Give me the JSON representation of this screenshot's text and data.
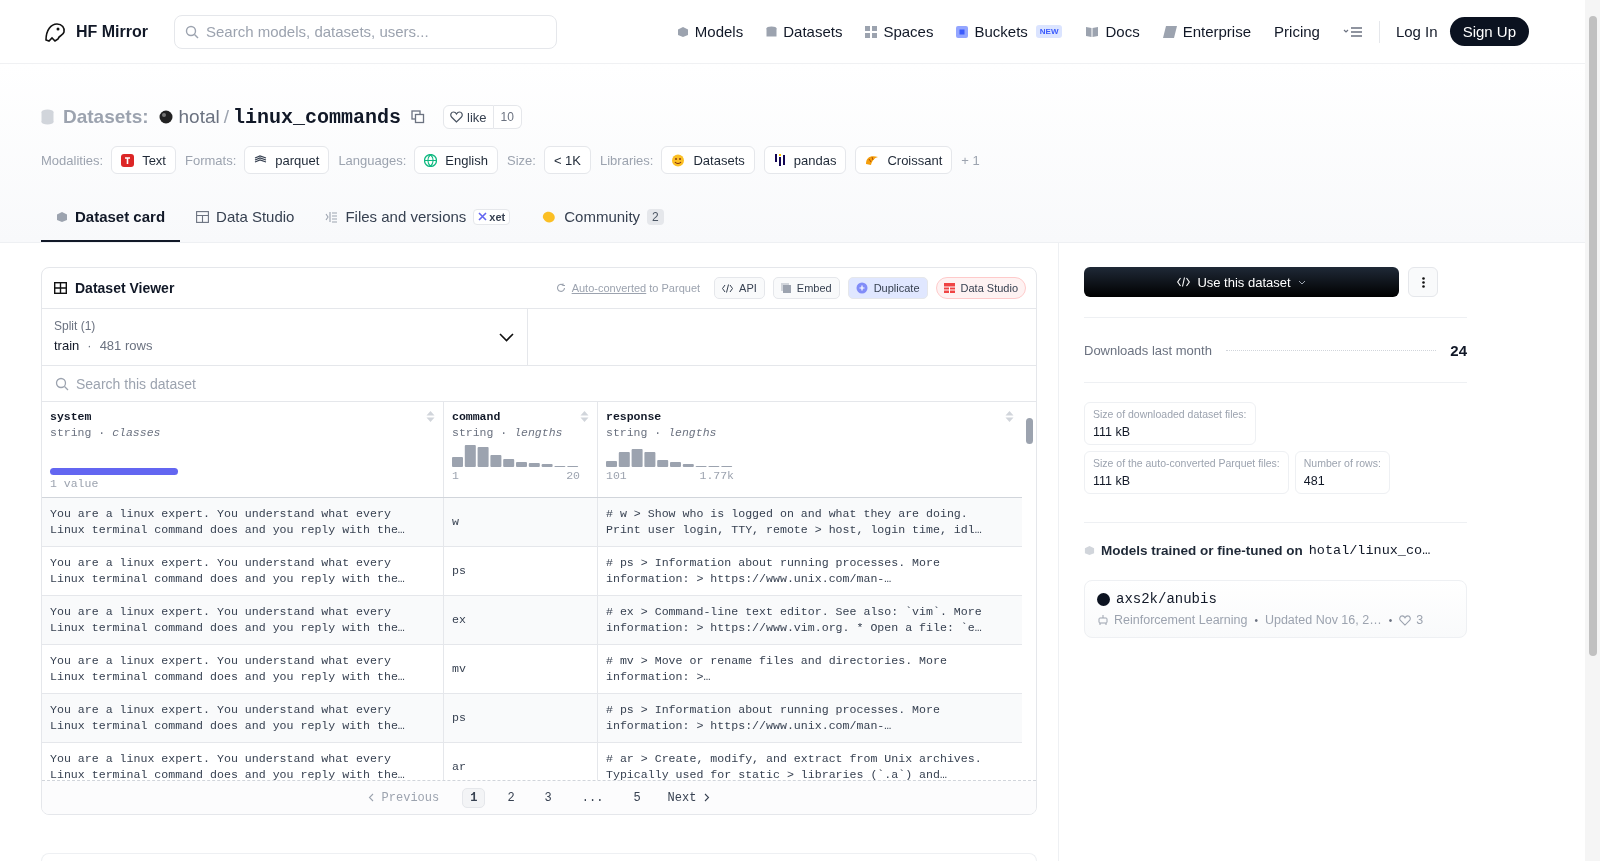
{
  "nav": {
    "logo": "HF Mirror",
    "search_placeholder": "Search models, datasets, users...",
    "links": [
      {
        "label": "Models",
        "kind": "models"
      },
      {
        "label": "Datasets",
        "kind": "datasets"
      },
      {
        "label": "Spaces",
        "kind": "spaces"
      },
      {
        "label": "Buckets",
        "kind": "buckets",
        "badge": "NEW"
      },
      {
        "label": "Docs",
        "kind": "docs"
      },
      {
        "label": "Enterprise",
        "kind": "enterprise"
      },
      {
        "label": "Pricing",
        "kind": "plain"
      }
    ],
    "login": "Log In",
    "signup": "Sign Up"
  },
  "repo": {
    "prefix": "Datasets:",
    "owner": "hotal",
    "separator": "/",
    "name": "linux_commands",
    "like": "like",
    "likes": "10"
  },
  "tag_groups": [
    {
      "label": "Modalities:",
      "items": [
        {
          "text": "Text",
          "kind": "text"
        }
      ]
    },
    {
      "label": "Formats:",
      "items": [
        {
          "text": "parquet",
          "kind": "parquet"
        }
      ]
    },
    {
      "label": "Languages:",
      "items": [
        {
          "text": "English",
          "kind": "globe"
        }
      ]
    },
    {
      "label": "Size:",
      "items": [
        {
          "text": "< 1K",
          "kind": "plain"
        }
      ]
    },
    {
      "label": "Libraries:",
      "items": [
        {
          "text": "Datasets",
          "kind": "hug"
        },
        {
          "text": "pandas",
          "kind": "pandas"
        },
        {
          "text": "Croissant",
          "kind": "croissant"
        }
      ]
    }
  ],
  "tags_more": "+ 1",
  "tabs": [
    {
      "label": "Dataset card",
      "kind": "card",
      "selected": true
    },
    {
      "label": "Data Studio",
      "kind": "table",
      "selected": false
    },
    {
      "label": "Files and versions",
      "kind": "files",
      "selected": false,
      "badge": "xet"
    },
    {
      "label": "Community",
      "kind": "community",
      "selected": false,
      "count": "2"
    }
  ],
  "viewer": {
    "title": "Dataset Viewer",
    "converted_link": "Auto-converted",
    "converted_rest": "to Parquet",
    "buttons": [
      {
        "label": "API",
        "kind": "api"
      },
      {
        "label": "Embed",
        "kind": "embed"
      },
      {
        "label": "Duplicate",
        "kind": "duplicate"
      },
      {
        "label": "Data Studio",
        "kind": "studio"
      }
    ],
    "dot": "·",
    "split_label": "Split (1)",
    "split_name": "train",
    "split_rows": "481 rows",
    "search_placeholder": "Search this dataset",
    "columns": [
      {
        "name": "system",
        "type": "string",
        "stat": "classes",
        "kind": "classes",
        "footer": "1 value"
      },
      {
        "name": "command",
        "type": "string",
        "stat": "lengths",
        "kind": "lengths",
        "min": "1",
        "max": "20"
      },
      {
        "name": "response",
        "type": "string",
        "stat": "lengths",
        "kind": "lengths",
        "min": "101",
        "max": "1.77k"
      }
    ],
    "rows": [
      [
        "You are a linux expert. You understand what every Linux terminal command does and you reply with the…",
        "w",
        "# w > Show who is logged on and what they are doing. Print user login, TTY, remote > host, login time, idl…"
      ],
      [
        "You are a linux expert. You understand what every Linux terminal command does and you reply with the…",
        "ps",
        "# ps > Information about running processes. More information: > https://www.unix.com/man-…"
      ],
      [
        "You are a linux expert. You understand what every Linux terminal command does and you reply with the…",
        "ex",
        "# ex > Command-line text editor. See also: `vim`. More information: > https://www.vim.org. * Open a file: `e…"
      ],
      [
        "You are a linux expert. You understand what every Linux terminal command does and you reply with the…",
        "mv",
        "# mv > Move or rename files and directories. More information: >…"
      ],
      [
        "You are a linux expert. You understand what every Linux terminal command does and you reply with the…",
        "ps",
        "# ps > Information about running processes. More information: > https://www.unix.com/man-…"
      ],
      [
        "You are a linux expert. You understand what every Linux terminal command does and you reply with the…",
        "ar",
        "# ar > Create, modify, and extract from Unix archives. Typically used for static > libraries (`.a`) and…"
      ]
    ],
    "pagination": {
      "previous": "Previous",
      "next": "Next",
      "pages": [
        {
          "label": "1",
          "selected": true
        },
        {
          "label": "2",
          "selected": false
        },
        {
          "label": "3",
          "selected": false
        },
        {
          "label": "...",
          "selected": false
        },
        {
          "label": "5",
          "selected": false
        }
      ]
    }
  },
  "sidebar": {
    "use_button": "Use this dataset",
    "downloads_label": "Downloads last month",
    "downloads": "24",
    "stats": [
      {
        "label": "Size of downloaded dataset files:",
        "value": "111 kB"
      },
      {
        "label": "Size of the auto-converted Parquet files:",
        "value": "111 kB"
      },
      {
        "label": "Number of rows:",
        "value": "481"
      }
    ],
    "models_heading": "Models trained or fine-tuned on",
    "models_repo": "hotal/linux_co…",
    "model": {
      "name": "axs2k/anubis",
      "task": "Reinforcement Learning",
      "updated": "Updated Nov 16, 2…",
      "likes": "3",
      "bullet": "•"
    }
  }
}
